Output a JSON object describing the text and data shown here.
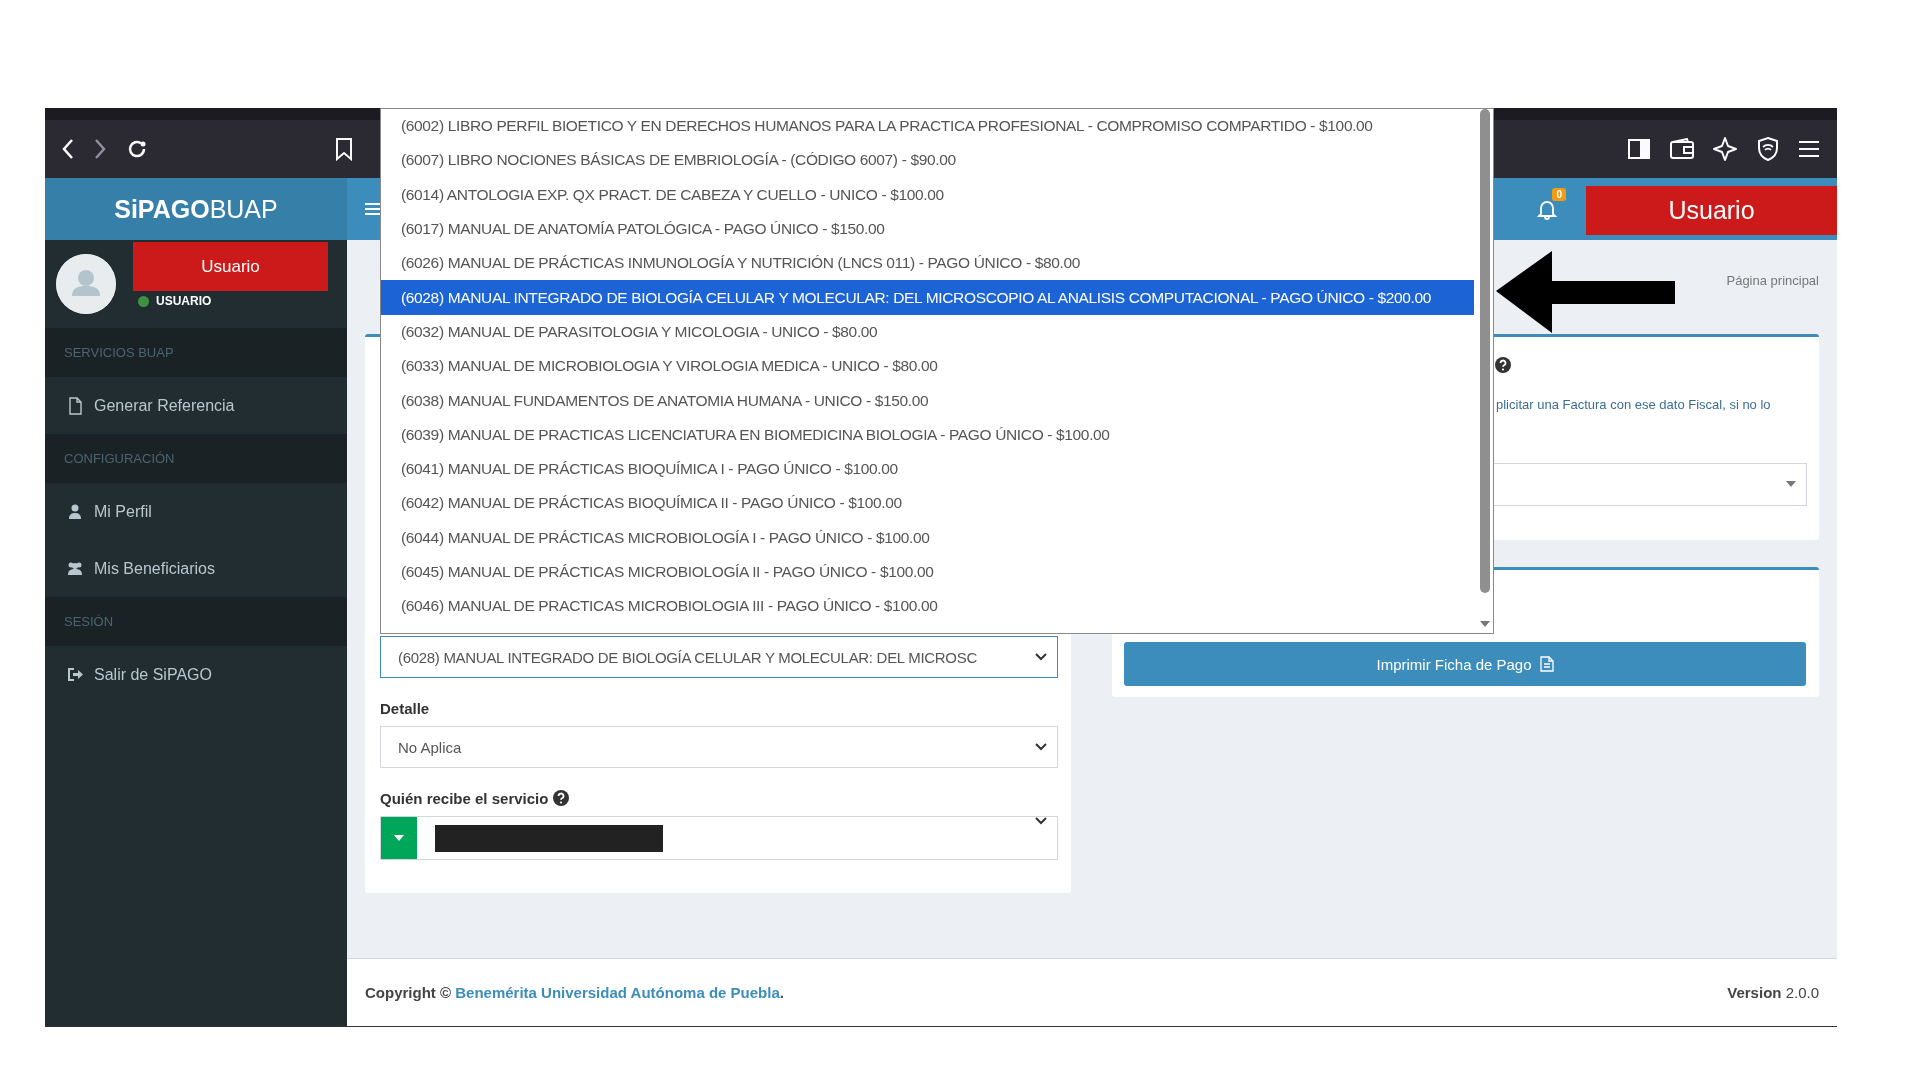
{
  "header": {
    "logo_bold": "SiPAGO",
    "logo_light": "BUAP",
    "notification_count": "0",
    "user_button": "Usuario"
  },
  "sidebar": {
    "user": {
      "name": "Usuario",
      "status": "USUARIO"
    },
    "sections": [
      {
        "title": "SERVICIOS BUAP",
        "items": [
          {
            "label": "Generar Referencia",
            "kind": "file"
          }
        ]
      },
      {
        "title": "CONFIGURACIÓN",
        "items": [
          {
            "label": "Mi Perfil",
            "kind": "user"
          },
          {
            "label": "Mis Beneficiarios",
            "kind": "users"
          }
        ]
      },
      {
        "title": "SESIÓN",
        "items": [
          {
            "label": "Salir de SiPAGO",
            "kind": "logout"
          }
        ]
      }
    ]
  },
  "content": {
    "breadcrumb": "Página principal"
  },
  "service_dropdown": {
    "options": [
      {
        "label": "(6002) LIBRO PERFIL BIOETICO Y EN DERECHOS HUMANOS PARA LA PRACTICA PROFESIONAL - COMPROMISO COMPARTIDO - $100.00",
        "selected": false
      },
      {
        "label": "(6007) LIBRO NOCIONES BÁSICAS DE EMBRIOLOGÍA - (CÓDIGO 6007) - $90.00",
        "selected": false
      },
      {
        "label": "(6014) ANTOLOGIA EXP. QX PRACT. DE CABEZA Y CUELLO - UNICO - $100.00",
        "selected": false
      },
      {
        "label": "(6017) MANUAL DE ANATOMÍA PATOLÓGICA - PAGO ÚNICO - $150.00",
        "selected": false
      },
      {
        "label": "(6026) MANUAL DE PRÁCTICAS INMUNOLOGÍA Y NUTRICIÓN (LNCS 011) - PAGO ÚNICO - $80.00",
        "selected": false
      },
      {
        "label": "(6028) MANUAL INTEGRADO DE BIOLOGÍA CELULAR Y MOLECULAR: DEL MICROSCOPIO AL ANALISIS COMPUTACIONAL - PAGO ÚNICO - $200.00",
        "selected": true
      },
      {
        "label": "(6032) MANUAL DE PARASITOLOGIA Y MICOLOGIA - UNICO - $80.00",
        "selected": false
      },
      {
        "label": "(6033) MANUAL DE MICROBIOLOGIA Y VIROLOGIA MEDICA - UNICO - $80.00",
        "selected": false
      },
      {
        "label": "(6038) MANUAL FUNDAMENTOS DE ANATOMIA HUMANA - UNICO - $150.00",
        "selected": false
      },
      {
        "label": "(6039) MANUAL DE PRACTICAS LICENCIATURA EN BIOMEDICINA BIOLOGIA - PAGO ÚNICO - $100.00",
        "selected": false
      },
      {
        "label": "(6041) MANUAL DE PRÁCTICAS BIOQUÍMICA I - PAGO ÚNICO - $100.00",
        "selected": false
      },
      {
        "label": "(6042) MANUAL DE PRÁCTICAS BIOQUÍMICA II - PAGO ÚNICO - $100.00",
        "selected": false
      },
      {
        "label": "(6044) MANUAL DE PRÁCTICAS MICROBIOLOGÍA I - PAGO ÚNICO - $100.00",
        "selected": false
      },
      {
        "label": "(6045) MANUAL DE PRÁCTICAS MICROBIOLOGÍA II - PAGO ÚNICO - $100.00",
        "selected": false
      },
      {
        "label": "(6046) MANUAL DE PRACTICAS MICROBIOLOGIA III - PAGO ÚNICO - $100.00",
        "selected": false
      }
    ],
    "value": "(6028) MANUAL INTEGRADO DE BIOLOGÍA CELULAR Y MOLECULAR: DEL MICROSC"
  },
  "detalle": {
    "label": "Detalle",
    "value": "No Aplica"
  },
  "receptor": {
    "label": "Quién recibe el servicio"
  },
  "factura_card": {
    "text": "plicitar una Factura con ese dato Fiscal, si no lo"
  },
  "print_button": {
    "label": "Imprimir Ficha de Pago"
  },
  "footer": {
    "copyright": "Copyright ©",
    "link": "Benemérita Universidad Autónoma de Puebla",
    "end": ".",
    "version": "**Version** 2.0.0"
  }
}
